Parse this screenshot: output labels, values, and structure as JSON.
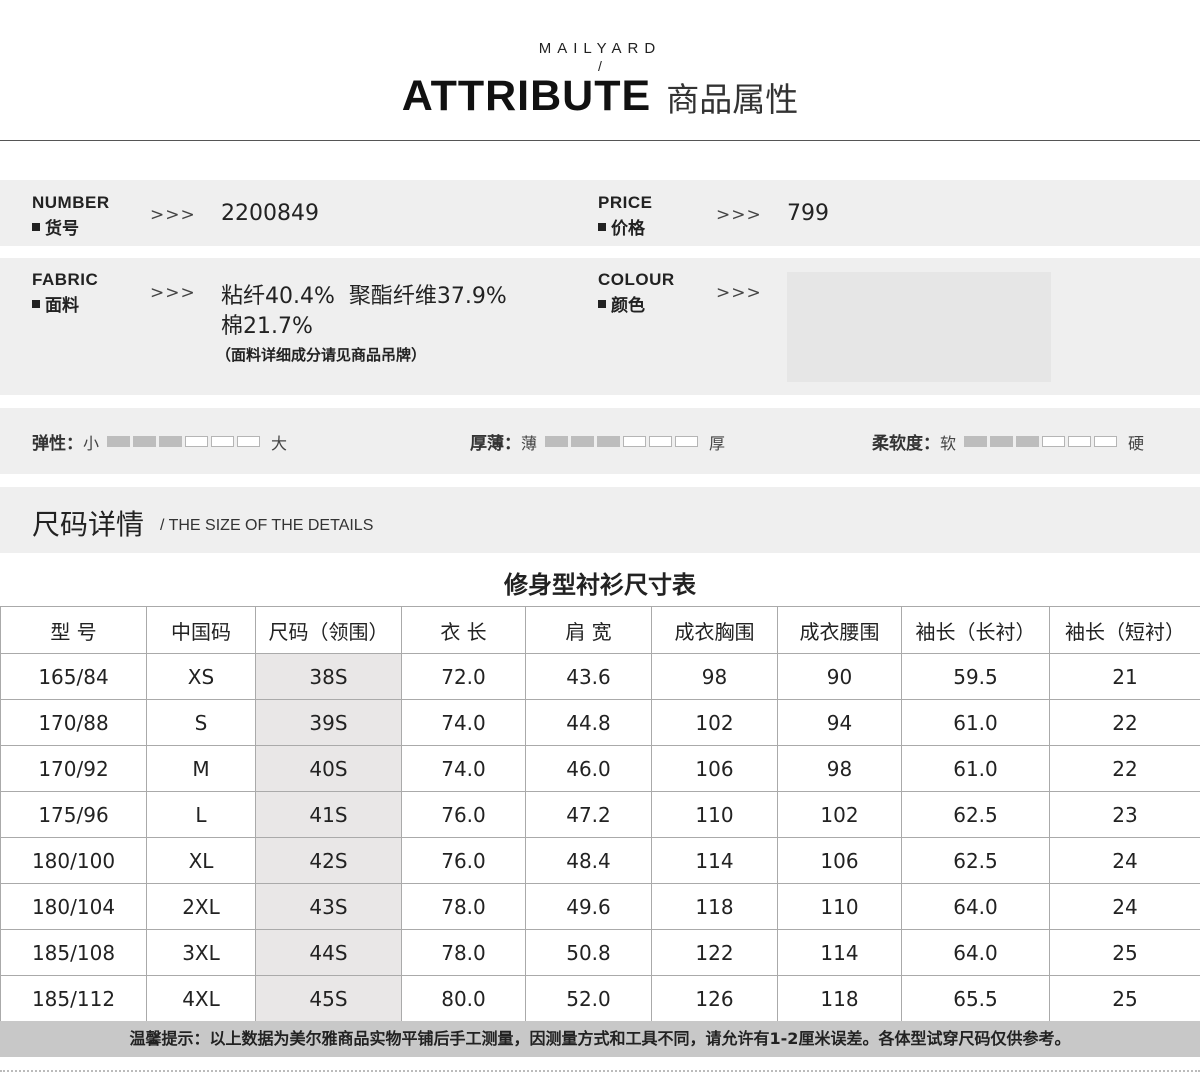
{
  "header": {
    "brand": "MAILYARD",
    "slash": "/",
    "title_en": "ATTRIBUTE",
    "title_cn": "商品属性"
  },
  "attributes": {
    "arrows": ">>>",
    "number": {
      "label_en": "NUMBER",
      "label_cn": "货号",
      "value": "2200849"
    },
    "price": {
      "label_en": "PRICE",
      "label_cn": "价格",
      "value": "799"
    },
    "fabric": {
      "label_en": "FABRIC",
      "label_cn": "面料",
      "line1": "粘纤40.4%  聚酯纤维37.9%",
      "line2": "棉21.7%",
      "note": "（面料详细成分请见商品吊牌）"
    },
    "colour": {
      "label_en": "COLOUR",
      "label_cn": "颜色",
      "swatch": "#e6e6e6"
    }
  },
  "meters": [
    {
      "label": "弹性：",
      "low": "小",
      "high": "大",
      "level": 3,
      "total": 6
    },
    {
      "label": "厚薄：",
      "low": "薄",
      "high": "厚",
      "level": 3,
      "total": 6
    },
    {
      "label": "柔软度：",
      "low": "软",
      "high": "硬",
      "level": 3,
      "total": 6
    }
  ],
  "size_section": {
    "title": "尺码详情",
    "subtitle": "/ THE SIZE OF THE DETAILS"
  },
  "table": {
    "title": "修身型衬衫尺寸表",
    "headers": [
      "型 号",
      "中国码",
      "尺码（领围）",
      "衣 长",
      "肩 宽",
      "成衣胸围",
      "成衣腰围",
      "袖长（长衬）",
      "袖长（短衬）"
    ],
    "rows": [
      [
        "165/84",
        "XS",
        "38S",
        "72.0",
        "43.6",
        "98",
        "90",
        "59.5",
        "21"
      ],
      [
        "170/88",
        "S",
        "39S",
        "74.0",
        "44.8",
        "102",
        "94",
        "61.0",
        "22"
      ],
      [
        "170/92",
        "M",
        "40S",
        "74.0",
        "46.0",
        "106",
        "98",
        "61.0",
        "22"
      ],
      [
        "175/96",
        "L",
        "41S",
        "76.0",
        "47.2",
        "110",
        "102",
        "62.5",
        "23"
      ],
      [
        "180/100",
        "XL",
        "42S",
        "76.0",
        "48.4",
        "114",
        "106",
        "62.5",
        "24"
      ],
      [
        "180/104",
        "2XL",
        "43S",
        "78.0",
        "49.6",
        "118",
        "110",
        "64.0",
        "24"
      ],
      [
        "185/108",
        "3XL",
        "44S",
        "78.0",
        "50.8",
        "122",
        "114",
        "64.0",
        "25"
      ],
      [
        "185/112",
        "4XL",
        "45S",
        "80.0",
        "52.0",
        "126",
        "118",
        "65.5",
        "25"
      ]
    ]
  },
  "footer": {
    "text": "温馨提示：以上数据为美尔雅商品实物平铺后手工测量，因测量方式和工具不同，请允许有1-2厘米误差。各体型试穿尺码仅供参考。"
  }
}
